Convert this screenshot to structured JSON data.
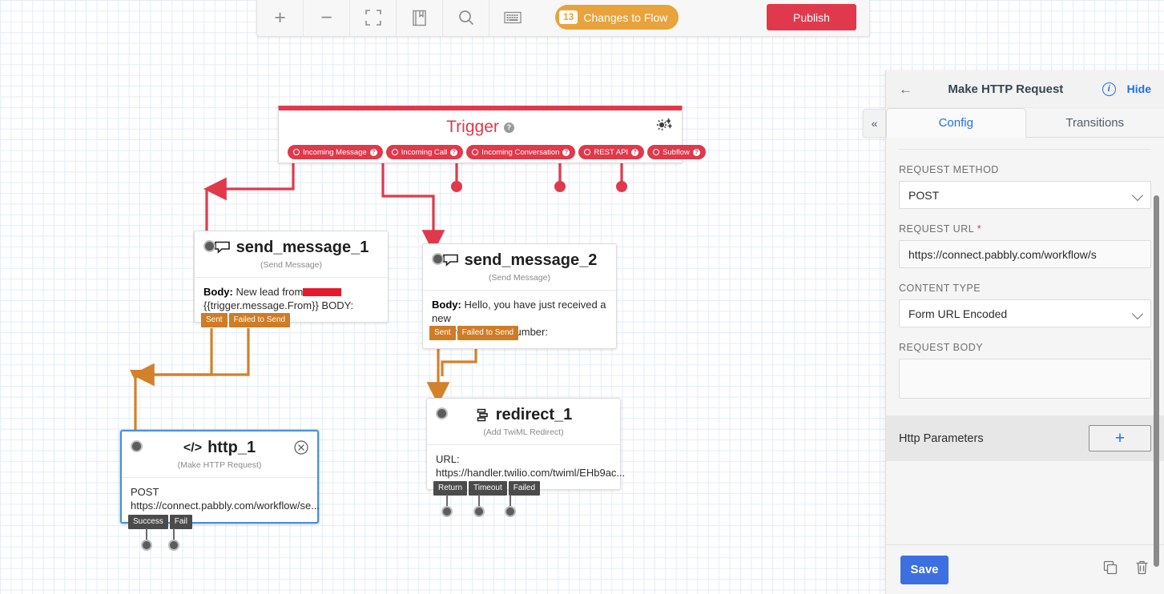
{
  "toolbar": {
    "buttons": [
      {
        "name": "zoom-in",
        "icon": "plus-icon",
        "label": "+"
      },
      {
        "name": "zoom-out",
        "icon": "minus-icon",
        "label": "−"
      },
      {
        "name": "fit-screen",
        "icon": "fit-screen-icon",
        "label": ""
      },
      {
        "name": "library",
        "icon": "book-icon",
        "label": ""
      },
      {
        "name": "search",
        "icon": "search-icon",
        "label": ""
      },
      {
        "name": "keyboard-shortcuts",
        "icon": "keyboard-icon",
        "label": ""
      }
    ],
    "changes_count": "13",
    "changes_label": "Changes to Flow",
    "publish_label": "Publish",
    "changes_color": "#e8a33d",
    "publish_color": "#e0394b"
  },
  "trigger": {
    "title": "Trigger",
    "help_glyph": "?",
    "gear_icon": "gear-icon",
    "accent": "#e0394b",
    "pills": [
      {
        "label": "Incoming Message"
      },
      {
        "label": "Incoming Call"
      },
      {
        "label": "Incoming Conversation"
      },
      {
        "label": "REST API"
      },
      {
        "label": "Subflow"
      }
    ]
  },
  "nodes": {
    "send_message_1": {
      "title": "send_message_1",
      "subtitle": "(Send Message)",
      "icon": "chat-bubble-icon",
      "body_label": "Body:",
      "body_text_1": "New lead from",
      "body_text_2": "{{trigger.message.From}} BODY:",
      "chips": [
        "Sent",
        "Failed to Send"
      ]
    },
    "send_message_2": {
      "title": "send_message_2",
      "subtitle": "(Send Message)",
      "icon": "chat-bubble-icon",
      "body_label": "Body:",
      "body_text_1": "Hello, you have just received a new",
      "body_text_2": "call from",
      "body_text_3": "Number:",
      "chips": [
        "Sent",
        "Failed to Send"
      ]
    },
    "redirect_1": {
      "title": "redirect_1",
      "subtitle": "(Add TwiML Redirect)",
      "icon": "redirect-icon",
      "body_label": "URL:",
      "body_text_1": "https://handler.twilio.com/twiml/EHb9ac...",
      "chips": [
        "Return",
        "Timeout",
        "Failed"
      ]
    },
    "http_1": {
      "title": "http_1",
      "subtitle": "(Make HTTP Request)",
      "icon": "code-icon",
      "close_icon": "close-circle-icon",
      "body_label": "POST",
      "body_text_1": "https://connect.pabbly.com/workflow/se...",
      "chips": [
        "Success",
        "Fail"
      ],
      "selected": true,
      "select_color": "#4a90d9"
    }
  },
  "panel": {
    "back_icon": "back-arrow-icon",
    "title": "Make HTTP Request",
    "info_icon": "info-icon",
    "info_glyph": "i",
    "hide_label": "Hide",
    "collapse_icon": "double-chevron-left-icon",
    "collapse_glyph": "«",
    "tabs": [
      {
        "label": "Config",
        "active": true
      },
      {
        "label": "Transitions",
        "active": false
      }
    ],
    "fields": {
      "request_method_label": "REQUEST METHOD",
      "request_method_value": "POST",
      "request_url_label": "REQUEST URL",
      "request_url_required": "*",
      "request_url_value": "https://connect.pabbly.com/workflow/s",
      "content_type_label": "CONTENT TYPE",
      "content_type_value": "Form URL Encoded",
      "request_body_label": "REQUEST BODY",
      "request_body_value": ""
    },
    "http_params_label": "Http Parameters",
    "http_params_add_glyph": "+",
    "save_label": "Save",
    "duplicate_icon": "copy-icon",
    "delete_icon": "trash-icon",
    "accent": "#1d6ff2"
  },
  "edges": {
    "trigger_color": "#e0394b",
    "flow_color": "#d3812a"
  }
}
